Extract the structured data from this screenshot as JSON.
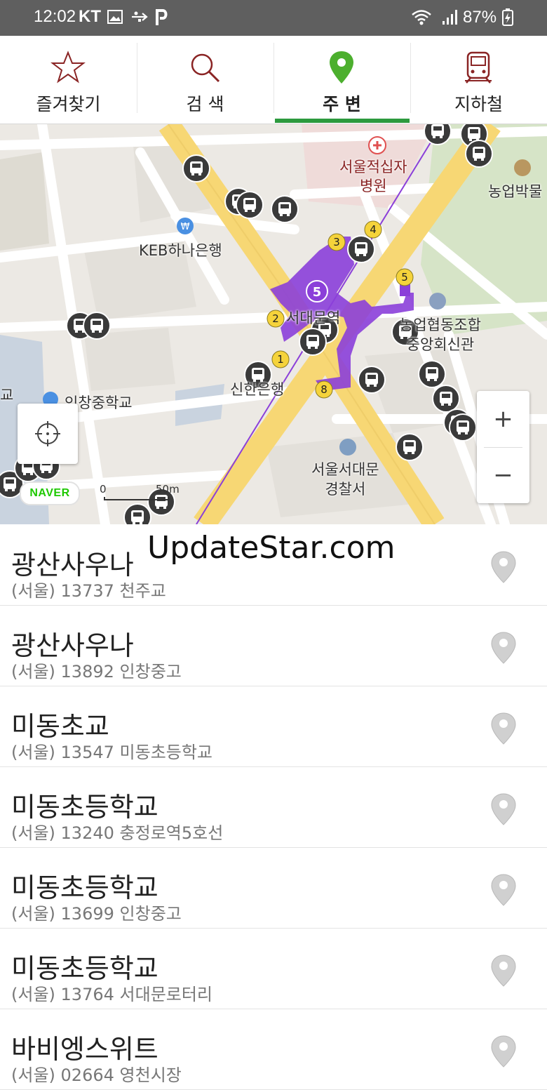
{
  "status_bar": {
    "time": "12:02",
    "carrier": "KT",
    "battery": "87%"
  },
  "tabs": [
    {
      "label": "즐겨찾기",
      "icon": "star-icon",
      "active": false
    },
    {
      "label": "검 색",
      "icon": "search-icon",
      "active": false
    },
    {
      "label": "주 변",
      "icon": "location-pin-icon",
      "active": true
    },
    {
      "label": "지하철",
      "icon": "subway-train-icon",
      "active": false
    }
  ],
  "map": {
    "labels": {
      "hospital": "서울적십자\n병원",
      "bank_keb": "KEB하나은행",
      "station": "서대문역",
      "museum": "농업박물",
      "nonghyup": "농업협동조합\n중앙회신관",
      "school": "인창중학교",
      "shinhan": "신한은행",
      "police": "서울서대문\n경찰서",
      "left_edge": "교"
    },
    "exit_numbers": [
      "1",
      "2",
      "3",
      "4",
      "5",
      "8"
    ],
    "line_number": "5",
    "zoom_in": "+",
    "zoom_out": "−",
    "provider": "NAVER",
    "scale": {
      "start": "0",
      "end": "50m"
    }
  },
  "watermark": "UpdateStar.com",
  "stops": [
    {
      "name": "광산사우나",
      "region": "(서울)",
      "id": "13737",
      "direction": "천주교"
    },
    {
      "name": "광산사우나",
      "region": "(서울)",
      "id": "13892",
      "direction": "인창중고"
    },
    {
      "name": "미동초교",
      "region": "(서울)",
      "id": "13547",
      "direction": "미동초등학교"
    },
    {
      "name": "미동초등학교",
      "region": "(서울)",
      "id": "13240",
      "direction": "충정로역5호선"
    },
    {
      "name": "미동초등학교",
      "region": "(서울)",
      "id": "13699",
      "direction": "인창중고"
    },
    {
      "name": "미동초등학교",
      "region": "(서울)",
      "id": "13764",
      "direction": "서대문로터리"
    },
    {
      "name": "바비엥스위트",
      "region": "(서울)",
      "id": "02664",
      "direction": "영천시장"
    }
  ],
  "colors": {
    "accent": "#2c9a3e",
    "icon_maroon": "#8a2424",
    "subway_line5": "#8b3fd9",
    "road_yellow": "#f7d774"
  }
}
